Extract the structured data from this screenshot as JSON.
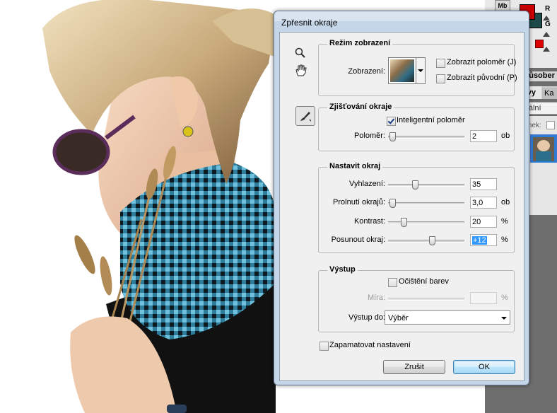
{
  "dialog": {
    "title": "Zpřesnit okraje",
    "view_mode": {
      "legend": "Režim zobrazení",
      "view_label": "Zobrazení:",
      "show_radius_label": "Zobrazit poloměr (J)",
      "show_radius_checked": false,
      "show_original_label": "Zobrazit původní (P)",
      "show_original_checked": false
    },
    "edge_detection": {
      "legend": "Zjišťování okraje",
      "smart_radius_label": "Inteligentní poloměr",
      "smart_radius_checked": true,
      "radius_label": "Poloměr:",
      "radius_value": "2",
      "radius_unit": "ob",
      "radius_slider_fraction": 0.02
    },
    "adjust_edge": {
      "legend": "Nastavit okraj",
      "smooth_label": "Vyhlazení:",
      "smooth_value": "35",
      "smooth_slider_fraction": 0.35,
      "feather_label": "Prolnutí okrajů:",
      "feather_value": "3,0",
      "feather_unit": "ob",
      "feather_slider_fraction": 0.03,
      "contrast_label": "Kontrast:",
      "contrast_value": "20",
      "contrast_unit": "%",
      "contrast_slider_fraction": 0.2,
      "shift_label": "Posunout okraj:",
      "shift_value": "+12",
      "shift_unit": "%",
      "shift_slider_fraction": 0.56
    },
    "output": {
      "legend": "Výstup",
      "decontaminate_label": "Očištění barev",
      "decontaminate_checked": false,
      "amount_label": "Míra:",
      "amount_value": "",
      "amount_unit": "%",
      "output_to_label": "Výstup do:",
      "output_to_value": "Výběr"
    },
    "remember_label": "Zapamatovat nastavení",
    "remember_checked": false,
    "cancel_label": "Zrušit",
    "ok_label": "OK"
  },
  "right_panel": {
    "mb_badge": "Mb",
    "channel_r": "R",
    "channel_g": "G",
    "blend_header": "způsober",
    "tab_layers": "stvy",
    "tab_channels": "Ka",
    "blend_mode": "rmální",
    "lock_label": "mek:",
    "foreground_color": "#cc0000",
    "background_color": "#1e4a4a"
  }
}
